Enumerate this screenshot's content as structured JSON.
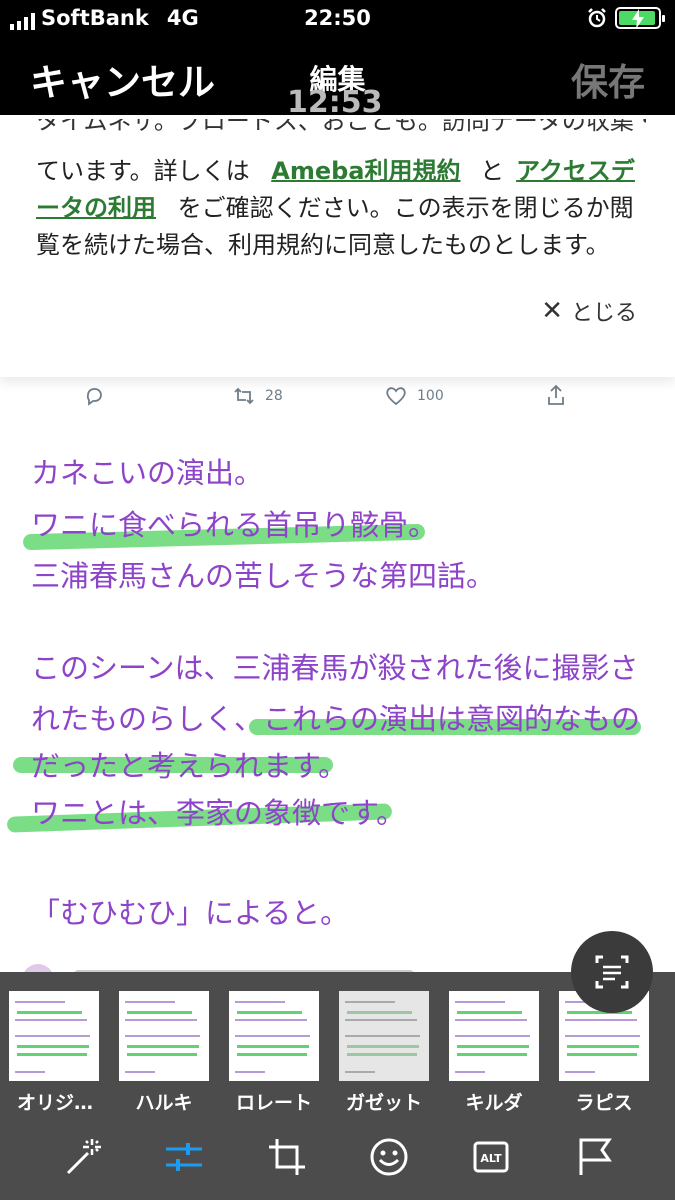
{
  "status_bar": {
    "carrier": "SoftBank",
    "network": "4G",
    "time": "22:50"
  },
  "nav": {
    "cancel": "キャンセル",
    "title": "編集",
    "save": "保存"
  },
  "consent": {
    "faded_time": "12:53",
    "clipped_line": "タイムネザ。ブロードス、おことも。訪問データの収集・利用して",
    "text_before": "ています。詳しくは",
    "link1": "Ameba利用規約",
    "mid": "と",
    "link2": "アクセスデータの利用",
    "text_after": "をご確認ください。この表示を閉じるか閲覧を続けた場合、利用規約に同意したものとします。",
    "close_label": "とじる"
  },
  "tweet_actions": {
    "retweets": "28",
    "likes": "100"
  },
  "article": {
    "lines": [
      "カネこいの演出。",
      "ワニに食べられる首吊り骸骨。",
      "三浦春馬さんの苦しそうな第四話。",
      "このシーンは、三浦春馬が殺された後に撮影さ",
      "れたものらしく、これらの演出は意図的なもの",
      "だったと考えられます。",
      "ワニとは、李家の象徴です。",
      "「むひむひ」によると。"
    ]
  },
  "filters": [
    {
      "label": "オリジ…"
    },
    {
      "label": "ハルキ"
    },
    {
      "label": "ロレート"
    },
    {
      "label": "ガゼット"
    },
    {
      "label": "キルダ"
    },
    {
      "label": "ラピス"
    }
  ],
  "toolbar_icons": [
    "magic-wand-icon",
    "adjust-sliders-icon",
    "crop-icon",
    "emoji-icon",
    "alt-text-icon",
    "flag-icon"
  ],
  "colors": {
    "article_text": "#8e44c9",
    "highlight": "#4fd35f",
    "link": "#2d7a33",
    "active_tool": "#1d9bf0"
  }
}
